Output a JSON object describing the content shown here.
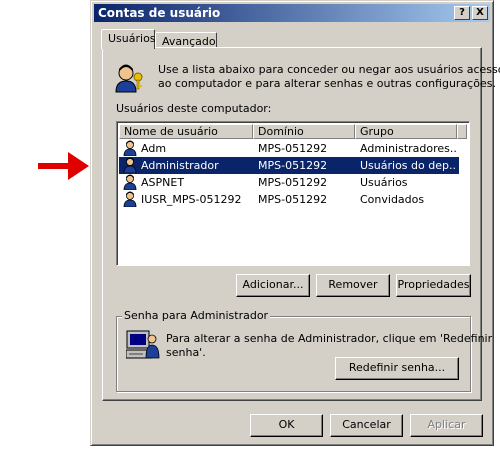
{
  "window": {
    "title": "Contas de usuário",
    "help_button": "?",
    "close_button": "X"
  },
  "tabs": [
    {
      "label": "Usuários",
      "active": true
    },
    {
      "label": "Avançado",
      "active": false
    }
  ],
  "intro": {
    "text_line1": "Use a lista abaixo para conceder ou negar aos usuários acesso",
    "text_line2": "ao computador e para alterar senhas e outras configurações."
  },
  "users_label": "Usuários deste computador:",
  "users_table": {
    "columns": [
      "Nome de usuário",
      "Domínio",
      "Grupo"
    ],
    "rows": [
      {
        "name": "Adm",
        "domain": "MPS-051292",
        "group": "Administradores...",
        "selected": false
      },
      {
        "name": "Administrador",
        "domain": "MPS-051292",
        "group": "Usuários do dep...",
        "selected": true
      },
      {
        "name": "ASPNET",
        "domain": "MPS-051292",
        "group": "Usuários",
        "selected": false
      },
      {
        "name": "IUSR_MPS-051292",
        "domain": "MPS-051292",
        "group": "Convidados",
        "selected": false
      }
    ]
  },
  "list_buttons": {
    "add": "Adicionar...",
    "remove": "Remover",
    "properties": "Propriedades"
  },
  "password_group": {
    "title": "Senha para Administrador",
    "text_line1": "Para alterar a senha de Administrador, clique em 'Redefinir",
    "text_line2": "senha'.",
    "reset_button": "Redefinir senha..."
  },
  "dialog_buttons": {
    "ok": "OK",
    "cancel": "Cancelar",
    "apply": "Aplicar",
    "apply_disabled": true
  },
  "colors": {
    "titlebar_start": "#0a246a",
    "titlebar_end": "#a6caf0",
    "selection": "#0a246a",
    "arrow": "#e00000",
    "face": "#d4d0c8"
  }
}
